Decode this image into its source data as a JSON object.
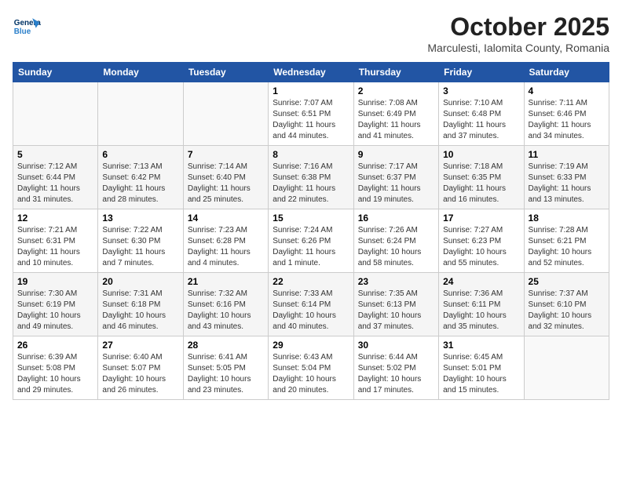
{
  "header": {
    "logo_line1": "General",
    "logo_line2": "Blue",
    "month": "October 2025",
    "location": "Marculesti, Ialomita County, Romania"
  },
  "weekdays": [
    "Sunday",
    "Monday",
    "Tuesday",
    "Wednesday",
    "Thursday",
    "Friday",
    "Saturday"
  ],
  "weeks": [
    [
      {
        "day": "",
        "detail": ""
      },
      {
        "day": "",
        "detail": ""
      },
      {
        "day": "",
        "detail": ""
      },
      {
        "day": "1",
        "detail": "Sunrise: 7:07 AM\nSunset: 6:51 PM\nDaylight: 11 hours\nand 44 minutes."
      },
      {
        "day": "2",
        "detail": "Sunrise: 7:08 AM\nSunset: 6:49 PM\nDaylight: 11 hours\nand 41 minutes."
      },
      {
        "day": "3",
        "detail": "Sunrise: 7:10 AM\nSunset: 6:48 PM\nDaylight: 11 hours\nand 37 minutes."
      },
      {
        "day": "4",
        "detail": "Sunrise: 7:11 AM\nSunset: 6:46 PM\nDaylight: 11 hours\nand 34 minutes."
      }
    ],
    [
      {
        "day": "5",
        "detail": "Sunrise: 7:12 AM\nSunset: 6:44 PM\nDaylight: 11 hours\nand 31 minutes."
      },
      {
        "day": "6",
        "detail": "Sunrise: 7:13 AM\nSunset: 6:42 PM\nDaylight: 11 hours\nand 28 minutes."
      },
      {
        "day": "7",
        "detail": "Sunrise: 7:14 AM\nSunset: 6:40 PM\nDaylight: 11 hours\nand 25 minutes."
      },
      {
        "day": "8",
        "detail": "Sunrise: 7:16 AM\nSunset: 6:38 PM\nDaylight: 11 hours\nand 22 minutes."
      },
      {
        "day": "9",
        "detail": "Sunrise: 7:17 AM\nSunset: 6:37 PM\nDaylight: 11 hours\nand 19 minutes."
      },
      {
        "day": "10",
        "detail": "Sunrise: 7:18 AM\nSunset: 6:35 PM\nDaylight: 11 hours\nand 16 minutes."
      },
      {
        "day": "11",
        "detail": "Sunrise: 7:19 AM\nSunset: 6:33 PM\nDaylight: 11 hours\nand 13 minutes."
      }
    ],
    [
      {
        "day": "12",
        "detail": "Sunrise: 7:21 AM\nSunset: 6:31 PM\nDaylight: 11 hours\nand 10 minutes."
      },
      {
        "day": "13",
        "detail": "Sunrise: 7:22 AM\nSunset: 6:30 PM\nDaylight: 11 hours\nand 7 minutes."
      },
      {
        "day": "14",
        "detail": "Sunrise: 7:23 AM\nSunset: 6:28 PM\nDaylight: 11 hours\nand 4 minutes."
      },
      {
        "day": "15",
        "detail": "Sunrise: 7:24 AM\nSunset: 6:26 PM\nDaylight: 11 hours\nand 1 minute."
      },
      {
        "day": "16",
        "detail": "Sunrise: 7:26 AM\nSunset: 6:24 PM\nDaylight: 10 hours\nand 58 minutes."
      },
      {
        "day": "17",
        "detail": "Sunrise: 7:27 AM\nSunset: 6:23 PM\nDaylight: 10 hours\nand 55 minutes."
      },
      {
        "day": "18",
        "detail": "Sunrise: 7:28 AM\nSunset: 6:21 PM\nDaylight: 10 hours\nand 52 minutes."
      }
    ],
    [
      {
        "day": "19",
        "detail": "Sunrise: 7:30 AM\nSunset: 6:19 PM\nDaylight: 10 hours\nand 49 minutes."
      },
      {
        "day": "20",
        "detail": "Sunrise: 7:31 AM\nSunset: 6:18 PM\nDaylight: 10 hours\nand 46 minutes."
      },
      {
        "day": "21",
        "detail": "Sunrise: 7:32 AM\nSunset: 6:16 PM\nDaylight: 10 hours\nand 43 minutes."
      },
      {
        "day": "22",
        "detail": "Sunrise: 7:33 AM\nSunset: 6:14 PM\nDaylight: 10 hours\nand 40 minutes."
      },
      {
        "day": "23",
        "detail": "Sunrise: 7:35 AM\nSunset: 6:13 PM\nDaylight: 10 hours\nand 37 minutes."
      },
      {
        "day": "24",
        "detail": "Sunrise: 7:36 AM\nSunset: 6:11 PM\nDaylight: 10 hours\nand 35 minutes."
      },
      {
        "day": "25",
        "detail": "Sunrise: 7:37 AM\nSunset: 6:10 PM\nDaylight: 10 hours\nand 32 minutes."
      }
    ],
    [
      {
        "day": "26",
        "detail": "Sunrise: 6:39 AM\nSunset: 5:08 PM\nDaylight: 10 hours\nand 29 minutes."
      },
      {
        "day": "27",
        "detail": "Sunrise: 6:40 AM\nSunset: 5:07 PM\nDaylight: 10 hours\nand 26 minutes."
      },
      {
        "day": "28",
        "detail": "Sunrise: 6:41 AM\nSunset: 5:05 PM\nDaylight: 10 hours\nand 23 minutes."
      },
      {
        "day": "29",
        "detail": "Sunrise: 6:43 AM\nSunset: 5:04 PM\nDaylight: 10 hours\nand 20 minutes."
      },
      {
        "day": "30",
        "detail": "Sunrise: 6:44 AM\nSunset: 5:02 PM\nDaylight: 10 hours\nand 17 minutes."
      },
      {
        "day": "31",
        "detail": "Sunrise: 6:45 AM\nSunset: 5:01 PM\nDaylight: 10 hours\nand 15 minutes."
      },
      {
        "day": "",
        "detail": ""
      }
    ]
  ]
}
